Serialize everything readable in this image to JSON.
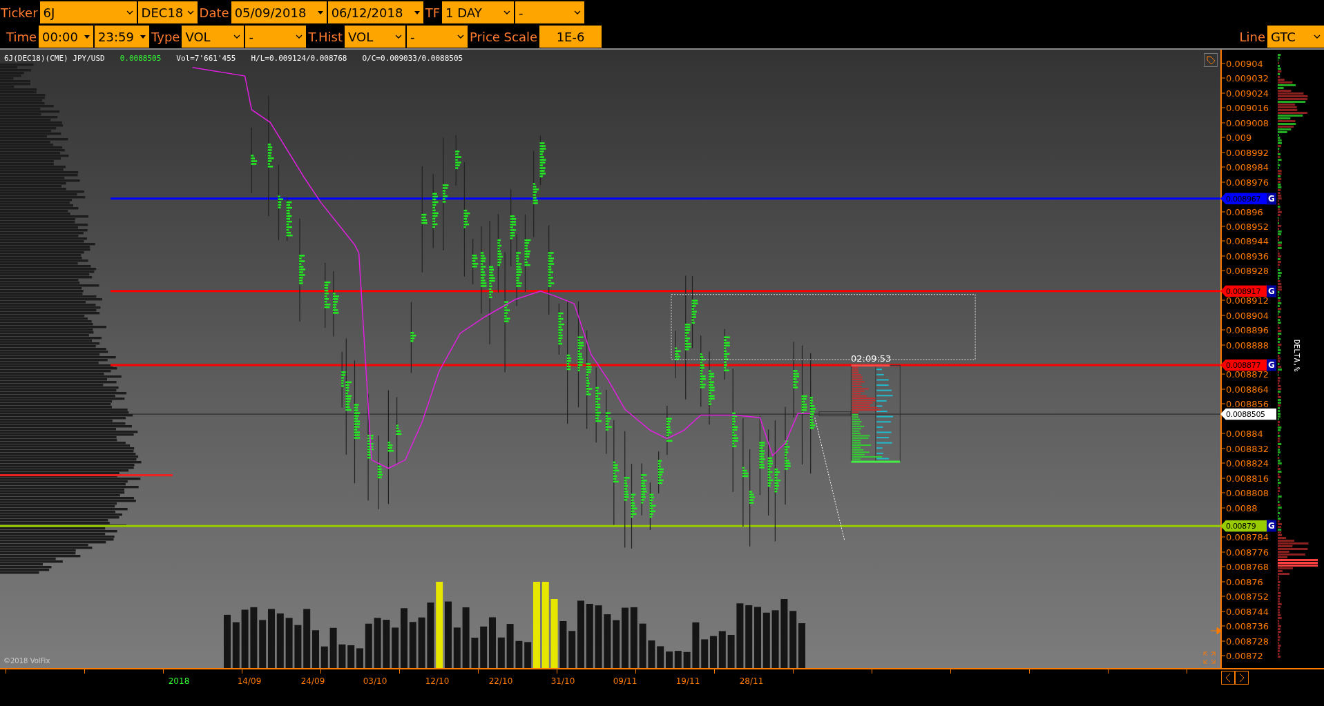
{
  "toolbar": {
    "upper_controls": [
      {
        "kind": "label",
        "text": "Ticker"
      },
      {
        "kind": "dropdown",
        "value": "6J"
      },
      {
        "kind": "dropdown",
        "value": "DEC18"
      },
      {
        "kind": "label",
        "text": "Date"
      },
      {
        "kind": "spinner",
        "value": "05/09/2018"
      },
      {
        "kind": "spinner",
        "value": "06/12/2018"
      },
      {
        "kind": "label",
        "text": "TF"
      },
      {
        "kind": "dropdown",
        "value": "1 DAY"
      },
      {
        "kind": "dropdown",
        "value": "-"
      }
    ],
    "lower_controls": [
      {
        "kind": "label",
        "text": "Time"
      },
      {
        "kind": "spinner",
        "value": "00:00"
      },
      {
        "kind": "spinner",
        "value": "23:59"
      },
      {
        "kind": "label",
        "text": "Type"
      },
      {
        "kind": "dropdown",
        "value": "VOL"
      },
      {
        "kind": "dropdown",
        "value": "-"
      },
      {
        "kind": "label",
        "text": "T.Hist"
      },
      {
        "kind": "dropdown",
        "value": "VOL"
      },
      {
        "kind": "dropdown",
        "value": "-"
      },
      {
        "kind": "label",
        "text": "Price Scale"
      },
      {
        "kind": "value",
        "value": "1E-6"
      }
    ],
    "right": [
      {
        "kind": "label",
        "text": "Line"
      },
      {
        "kind": "dropdown",
        "value": "GTC"
      }
    ]
  },
  "chart": {
    "header": {
      "instrument": "6J(DEC18)(CME) JPY/USD",
      "last": "0.0088505",
      "volume": "Vol=7'661'455",
      "high_low": "H/L=0.009124/0.008768",
      "open_close": "O/C=0.009033/0.0088505"
    },
    "countdown": "02:09:53",
    "copyright": "©2018 VolFix",
    "delta_label": "DELTA,%",
    "price_ticks": [
      "0.00904",
      "0.009032",
      "0.009024",
      "0.009016",
      "0.009008",
      "0.009",
      "0.008992",
      "0.008984",
      "0.008976",
      "0.00896",
      "0.008952",
      "0.008944",
      "0.008936",
      "0.008928",
      "0.008912",
      "0.008904",
      "0.008896",
      "0.008888",
      "0.008872",
      "0.008864",
      "0.008856",
      "0.00884",
      "0.008832",
      "0.008824",
      "0.008816",
      "0.008808",
      "0.0088",
      "0.008784",
      "0.008776",
      "0.008768",
      "0.00876",
      "0.008752",
      "0.008744",
      "0.008736",
      "0.008728",
      "0.00872"
    ],
    "levels": [
      {
        "price": "0.008967",
        "color": "#0000ff",
        "badge": "G"
      },
      {
        "price": "0.008917",
        "color": "#ff0000",
        "badge": "G"
      },
      {
        "price": "0.008877",
        "color": "#ff0000",
        "badge": "G"
      },
      {
        "price": "0.0088505",
        "color": "#ffffff"
      },
      {
        "price": "0.00879",
        "color": "#99cc00",
        "badge": "G"
      }
    ],
    "year_label": "2018",
    "dates": [
      "14/09",
      "24/09",
      "03/10",
      "12/10",
      "22/10",
      "31/10",
      "09/11",
      "19/11",
      "28/11"
    ]
  }
}
